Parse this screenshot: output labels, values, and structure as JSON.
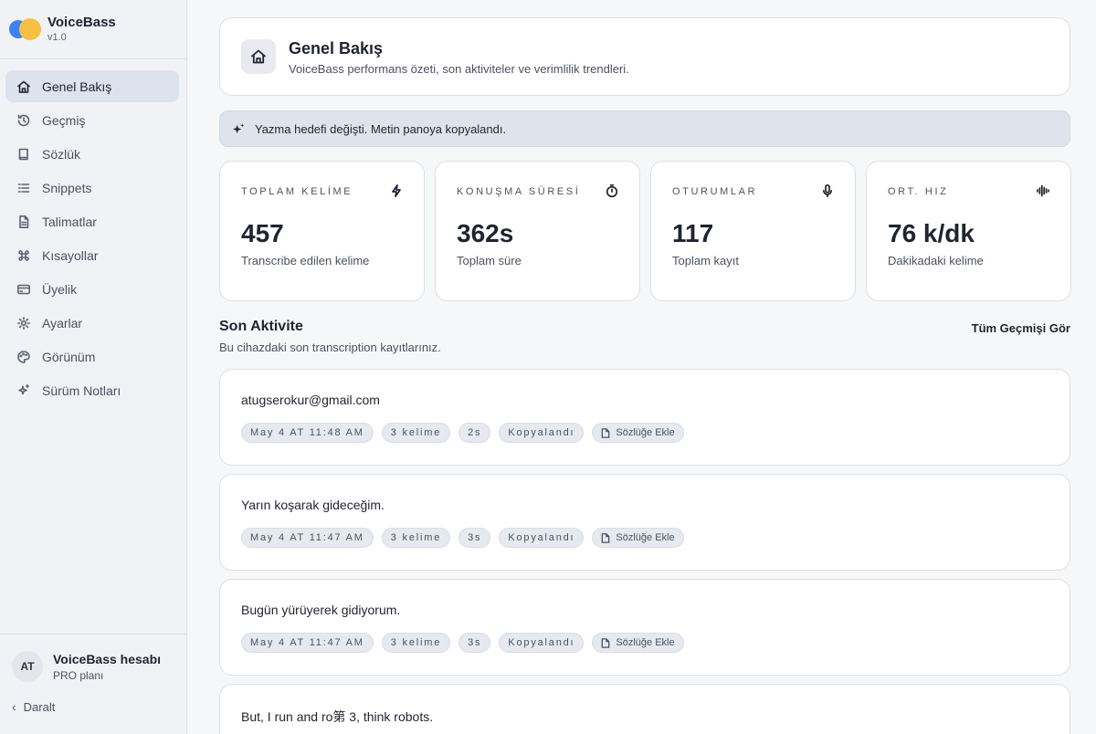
{
  "app": {
    "name": "VoiceBass",
    "version": "v1.0"
  },
  "sidebar": {
    "items": [
      {
        "label": "Genel Bakış",
        "icon": "home-icon",
        "active": true
      },
      {
        "label": "Geçmiş",
        "icon": "history-icon"
      },
      {
        "label": "Sözlük",
        "icon": "book-icon"
      },
      {
        "label": "Snippets",
        "icon": "list-icon"
      },
      {
        "label": "Talimatlar",
        "icon": "document-icon"
      },
      {
        "label": "Kısayollar",
        "icon": "command-icon"
      },
      {
        "label": "Üyelik",
        "icon": "credit-card-icon"
      },
      {
        "label": "Ayarlar",
        "icon": "gear-icon"
      },
      {
        "label": "Görünüm",
        "icon": "palette-icon"
      },
      {
        "label": "Sürüm Notları",
        "icon": "sparkle-icon"
      }
    ],
    "account": {
      "initials": "AT",
      "name": "VoiceBass hesabı",
      "plan": "PRO planı"
    },
    "collapse_label": "Daralt"
  },
  "header": {
    "title": "Genel Bakış",
    "subtitle": "VoiceBass performans özeti, son aktiviteler ve verimlilik trendleri."
  },
  "banner": {
    "text": "Yazma hedefi değişti. Metin panoya kopyalandı."
  },
  "stats": [
    {
      "label": "TOPLAM KELİME",
      "value": "457",
      "desc": "Transcribe edilen kelime",
      "icon": "lightning-icon"
    },
    {
      "label": "KONUŞMA SÜRESİ",
      "value": "362s",
      "desc": "Toplam süre",
      "icon": "stopwatch-icon"
    },
    {
      "label": "OTURUMLAR",
      "value": "117",
      "desc": "Toplam kayıt",
      "icon": "microphone-icon"
    },
    {
      "label": "ORT. HIZ",
      "value": "76 k/dk",
      "desc": "Dakikadaki kelime",
      "icon": "waveform-icon"
    }
  ],
  "activity": {
    "title": "Son Aktivite",
    "subtitle": "Bu cihazdaki son transcription kayıtlarınız.",
    "see_all": "Tüm Geçmişi Gör",
    "items": [
      {
        "text": "atugserokur@gmail.com",
        "time": "May 4 AT 11:48 AM",
        "words": "3 kelime",
        "duration": "2s",
        "status": "Kopyalandı",
        "action": "Sözlüğe Ekle"
      },
      {
        "text": "Yarın koşarak gideceğim.",
        "time": "May 4 AT 11:47 AM",
        "words": "3 kelime",
        "duration": "3s",
        "status": "Kopyalandı",
        "action": "Sözlüğe Ekle"
      },
      {
        "text": "Bugün yürüyerek gidiyorum.",
        "time": "May 4 AT 11:47 AM",
        "words": "3 kelime",
        "duration": "3s",
        "status": "Kopyalandı",
        "action": "Sözlüğe Ekle"
      },
      {
        "text": "But, I run and ro第 3, think robots."
      }
    ]
  }
}
